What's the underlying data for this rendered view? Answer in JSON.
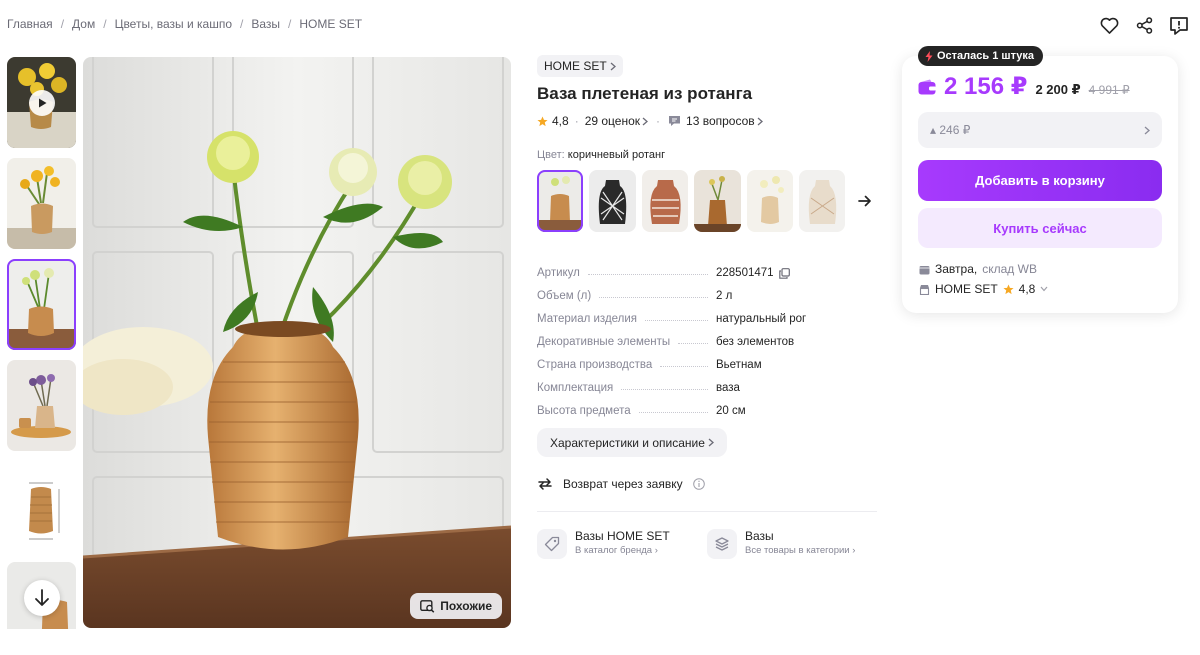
{
  "breadcrumb": [
    "Главная",
    "Дом",
    "Цветы, вазы и кашпо",
    "Вазы",
    "HOME SET"
  ],
  "breadcrumb_sep": "/",
  "gallery": {
    "similar_label": "Похожие"
  },
  "product": {
    "brand": "HOME SET",
    "title": "Ваза плетеная из ротанга",
    "rating": "4,8",
    "reviews": "29 оценок",
    "questions": "13 вопросов",
    "color_label": "Цвет:",
    "color_value": "коричневый ротанг"
  },
  "specs": [
    {
      "key": "Артикул",
      "value": "228501471"
    },
    {
      "key": "Объем (л)",
      "value": "2 л"
    },
    {
      "key": "Материал изделия",
      "value": "натуральный рог"
    },
    {
      "key": "Декоративные элементы",
      "value": "без элементов"
    },
    {
      "key": "Страна производства",
      "value": "Вьетнам"
    },
    {
      "key": "Комплектация",
      "value": "ваза"
    },
    {
      "key": "Высота предмета",
      "value": "20 см"
    }
  ],
  "chars_button": "Характеристики и описание",
  "return_text": "Возврат через заявку",
  "links": [
    {
      "title": "Вазы HOME SET",
      "sub": "В каталог бренда"
    },
    {
      "title": "Вазы",
      "sub": "Все товары в категории"
    }
  ],
  "buy": {
    "stock": "Осталась 1 штука",
    "price": "2 156 ₽",
    "price_mid": "2 200 ₽",
    "price_old": "4 991 ₽",
    "savings": "246 ₽",
    "add_to_cart": "Добавить в корзину",
    "buy_now": "Купить сейчас",
    "delivery_day": "Завтра,",
    "delivery_from": "склад WB",
    "seller": "HOME SET",
    "seller_rating": "4,8"
  },
  "colors": {
    "accent": "#a73afd",
    "star": "#f6a823",
    "badge_bg": "#242424"
  }
}
